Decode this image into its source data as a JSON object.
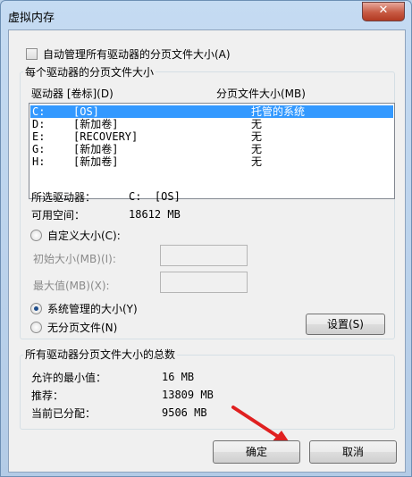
{
  "window": {
    "title": "虚拟内存",
    "close_label": "✕"
  },
  "auto_manage": {
    "label": "自动管理所有驱动器的分页文件大小(A)",
    "checked": false
  },
  "per_drive": {
    "group_label": "每个驱动器的分页文件大小",
    "headers": {
      "drive": "驱动器 [卷标](D)",
      "size": "分页文件大小(MB)"
    },
    "rows": [
      {
        "drive": "C:",
        "label": "[OS]",
        "size": "托管的系统",
        "selected": true
      },
      {
        "drive": "D:",
        "label": "[新加卷]",
        "size": "无",
        "selected": false
      },
      {
        "drive": "E:",
        "label": "[RECOVERY]",
        "size": "无",
        "selected": false
      },
      {
        "drive": "G:",
        "label": "[新加卷]",
        "size": "无",
        "selected": false
      },
      {
        "drive": "H:",
        "label": "[新加卷]",
        "size": "无",
        "selected": false
      }
    ],
    "selected_drive_label": "所选驱动器：",
    "selected_drive_value": "C:  [OS]",
    "free_space_label": "可用空间：",
    "free_space_value": "18612 MB",
    "custom_size_label": "自定义大小(C):",
    "initial_size_label": "初始大小(MB)(I):",
    "initial_size_value": "",
    "max_size_label": "最大值(MB)(X):",
    "max_size_value": "",
    "system_managed_label": "系统管理的大小(Y)",
    "no_paging_label": "无分页文件(N)",
    "set_button": "设置(S)",
    "selected_option": "system_managed"
  },
  "totals": {
    "group_label": "所有驱动器分页文件大小的总数",
    "min_label": "允许的最小值：",
    "min_value": "16 MB",
    "recommended_label": "推荐：",
    "recommended_value": "13809 MB",
    "allocated_label": "当前已分配：",
    "allocated_value": "9506 MB"
  },
  "buttons": {
    "ok": "确定",
    "cancel": "取消"
  },
  "annotation_arrow_color": "#e02020"
}
